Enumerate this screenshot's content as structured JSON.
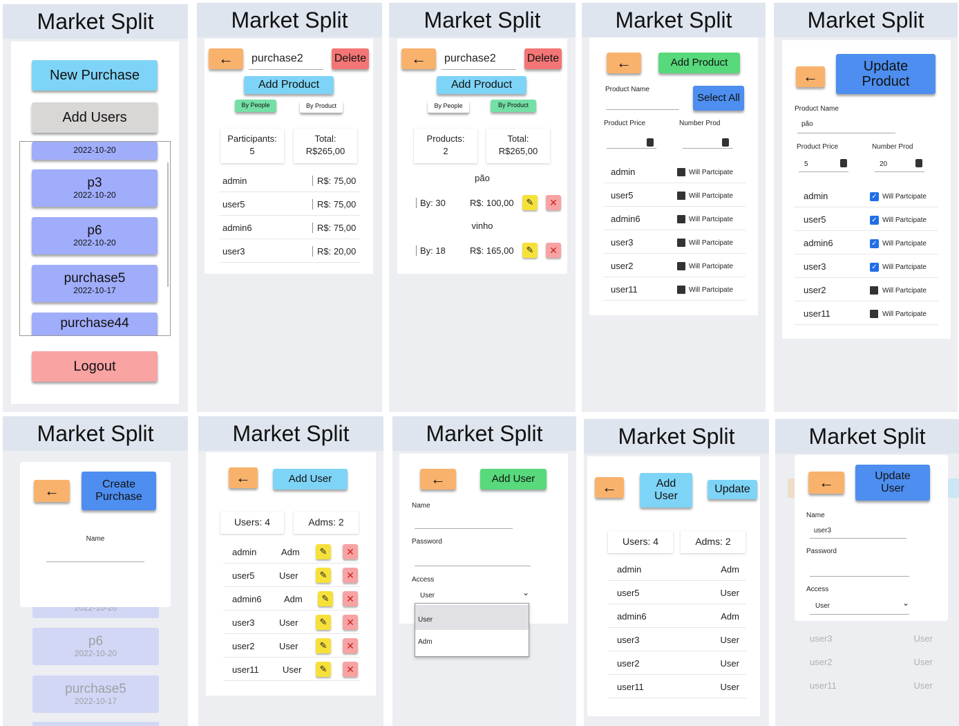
{
  "app_title": "Market Split",
  "icons": {
    "back": "←",
    "edit": "✎",
    "close": "✕",
    "check": "✓",
    "chevron": "⌄"
  },
  "home": {
    "new_purchase": "New Purchase",
    "add_users": "Add Users",
    "items": [
      {
        "name": "",
        "date": "2022-10-20"
      },
      {
        "name": "p3",
        "date": "2022-10-20"
      },
      {
        "name": "p6",
        "date": "2022-10-20"
      },
      {
        "name": "purchase5",
        "date": "2022-10-17"
      },
      {
        "name": "purchase44",
        "date": ""
      }
    ],
    "logout": "Logout"
  },
  "purchase_people": {
    "name": "purchase2",
    "delete": "Delete",
    "add_product": "Add Product",
    "by_people": "By People",
    "by_product": "By Product",
    "participants_label": "Participants:",
    "participants": "5",
    "total_label": "Total:",
    "total": "R$265,00",
    "rows": [
      {
        "name": "admin",
        "value": "R$: 75,00"
      },
      {
        "name": "user5",
        "value": "R$: 75,00"
      },
      {
        "name": "admin6",
        "value": "R$: 75,00"
      },
      {
        "name": "user3",
        "value": "R$: 20,00"
      }
    ]
  },
  "purchase_products": {
    "name": "purchase2",
    "delete": "Delete",
    "add_product": "Add Product",
    "by_people": "By People",
    "by_product": "By Product",
    "products_label": "Products:",
    "products": "2",
    "total_label": "Total:",
    "total": "R$265,00",
    "items": [
      {
        "name": "pão",
        "by": "By: 30",
        "price": "R$: 100,00"
      },
      {
        "name": "vinho",
        "by": "By: 18",
        "price": "R$: 165,00"
      }
    ]
  },
  "add_product": {
    "submit": "Add Product",
    "select_all": "Select All",
    "name_label": "Product Name",
    "price_label": "Product Price",
    "number_label": "Number Prod",
    "participate": "Will Partcipate",
    "users": [
      "admin",
      "user5",
      "admin6",
      "user3",
      "user2",
      "user11"
    ]
  },
  "update_product": {
    "submit_l1": "Update",
    "submit_l2": "Product",
    "name_label": "Product Name",
    "name_value": "pão",
    "price_label": "Product Price",
    "price_value": "5",
    "number_label": "Number Prod",
    "number_value": "20",
    "participate": "Will Partcipate",
    "users": [
      {
        "name": "admin",
        "checked": true
      },
      {
        "name": "user5",
        "checked": true
      },
      {
        "name": "admin6",
        "checked": true
      },
      {
        "name": "user3",
        "checked": true
      },
      {
        "name": "user2",
        "checked": false
      },
      {
        "name": "user11",
        "checked": false
      }
    ]
  },
  "create_purchase": {
    "submit_l1": "Create",
    "submit_l2": "Purchase",
    "name_label": "Name",
    "bg_dates": [
      "2022-10-20",
      "2022-10-20",
      "2022-10-17"
    ],
    "bg_names": [
      "p6",
      "purchase5"
    ]
  },
  "users_list": {
    "add_user": "Add User",
    "users_label": "Users: 4",
    "adms_label": "Adms: 2",
    "rows": [
      {
        "name": "admin",
        "role": "Adm"
      },
      {
        "name": "user5",
        "role": "User"
      },
      {
        "name": "admin6",
        "role": "Adm"
      },
      {
        "name": "user3",
        "role": "User"
      },
      {
        "name": "user2",
        "role": "User"
      },
      {
        "name": "user11",
        "role": "User"
      }
    ]
  },
  "add_user_form": {
    "submit": "Add User",
    "name_label": "Name",
    "password_label": "Password",
    "access_label": "Access",
    "access_value": "User",
    "options": [
      "User",
      "Adm"
    ]
  },
  "users_select": {
    "add_l1": "Add",
    "add_l2": "User",
    "update": "Update",
    "users_label": "Users: 4",
    "adms_label": "Adms: 2",
    "rows": [
      {
        "name": "admin",
        "role": "Adm"
      },
      {
        "name": "user5",
        "role": "User"
      },
      {
        "name": "admin6",
        "role": "Adm"
      },
      {
        "name": "user3",
        "role": "User"
      },
      {
        "name": "user2",
        "role": "User"
      },
      {
        "name": "user11",
        "role": "User"
      }
    ]
  },
  "update_user": {
    "submit_l1": "Update",
    "submit_l2": "User",
    "name_label": "Name",
    "name_value": "user3",
    "password_label": "Password",
    "access_label": "Access",
    "access_value": "User",
    "bg_rows": [
      {
        "name": "user3",
        "role": "User"
      },
      {
        "name": "user2",
        "role": "User"
      },
      {
        "name": "user11",
        "role": "User"
      }
    ]
  }
}
